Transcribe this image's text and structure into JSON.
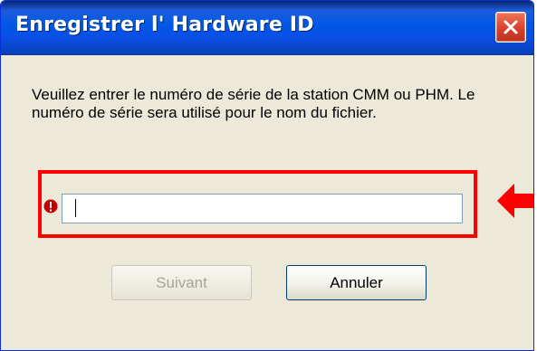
{
  "window": {
    "title": "Enregistrer l' Hardware ID",
    "close_icon": "close-icon"
  },
  "message": {
    "text": "Veuillez entrer le numéro de série de la station CMM ou PHM. Le numéro de série sera utilisé pour le nom du fichier."
  },
  "serial_field": {
    "value": "",
    "placeholder": ""
  },
  "indicators": {
    "error_icon": "error-icon",
    "arrow_icon": "arrow-left-icon",
    "highlight_color": "#ff0000"
  },
  "buttons": {
    "next_label": "Suivant",
    "cancel_label": "Annuler"
  },
  "colors": {
    "titlebar": "#0058e6",
    "dialog_background": "#ece9d8",
    "close_button": "#d9412b",
    "disabled_text": "#a7a59b"
  }
}
